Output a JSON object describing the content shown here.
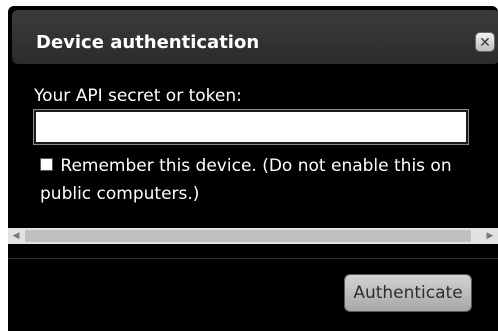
{
  "dialog": {
    "title": "Device authentication",
    "close_icon": "close-icon",
    "token_label": "Your API secret or token:",
    "token_value": "",
    "remember_checked": false,
    "remember_label": "Remember this device. (Do not enable this on public computers.)",
    "authenticate_label": "Authenticate"
  },
  "scrollbar": {
    "left_arrow": "◀",
    "right_arrow": "▶"
  }
}
